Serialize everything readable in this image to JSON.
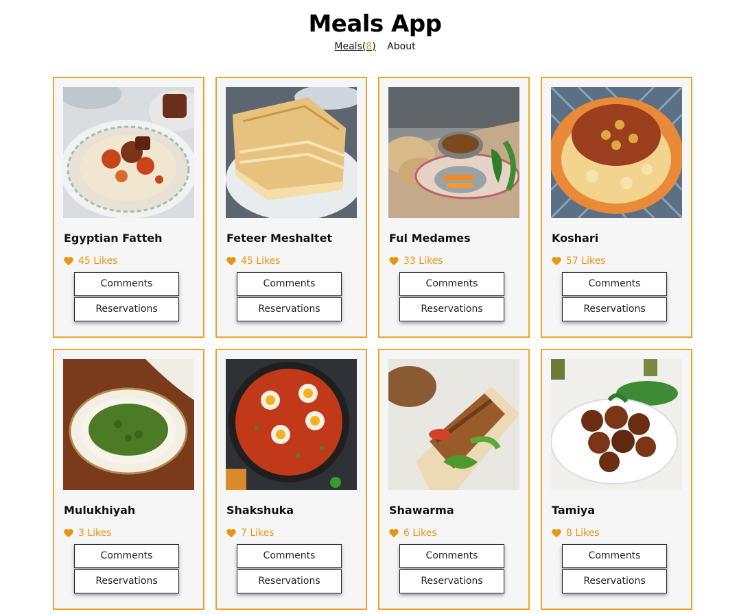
{
  "header": {
    "title": "Meals App",
    "nav_meals": "Meals(",
    "nav_count": "8",
    "nav_close": ")",
    "nav_about": "About"
  },
  "colors": {
    "accent": "#f0a32a",
    "like": "#e8950f",
    "card_bg": "#f6f6f6"
  },
  "meals": [
    {
      "name": "Egyptian Fatteh",
      "likes": "45 Likes",
      "comments": "Comments",
      "reservations": "Reservations",
      "image": "rice-beef-plate"
    },
    {
      "name": "Feteer Meshaltet",
      "likes": "45 Likes",
      "comments": "Comments",
      "reservations": "Reservations",
      "image": "layered-pastry"
    },
    {
      "name": "Ful Medames",
      "likes": "33 Likes",
      "comments": "Comments",
      "reservations": "Reservations",
      "image": "beans-bread-platter"
    },
    {
      "name": "Koshari",
      "likes": "57 Likes",
      "comments": "Comments",
      "reservations": "Reservations",
      "image": "pasta-rice-chickpeas"
    },
    {
      "name": "Mulukhiyah",
      "likes": "3 Likes",
      "comments": "Comments",
      "reservations": "Reservations",
      "image": "green-soup-bowl"
    },
    {
      "name": "Shakshuka",
      "likes": "7 Likes",
      "comments": "Comments",
      "reservations": "Reservations",
      "image": "eggs-tomato-pan"
    },
    {
      "name": "Shawarma",
      "likes": "6 Likes",
      "comments": "Comments",
      "reservations": "Reservations",
      "image": "meat-wrap"
    },
    {
      "name": "Tamiya",
      "likes": "8 Likes",
      "comments": "Comments",
      "reservations": "Reservations",
      "image": "falafel-plate"
    }
  ]
}
